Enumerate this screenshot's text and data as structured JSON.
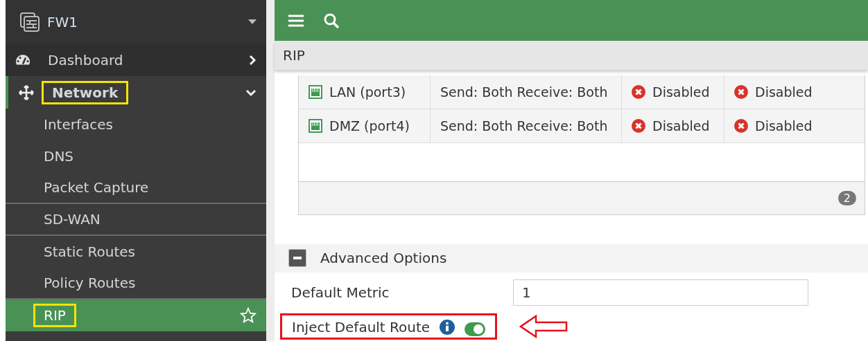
{
  "sidebar": {
    "device": "FW1",
    "items": [
      {
        "label": "Dashboard",
        "kind": "section",
        "expanded": false,
        "selected": false,
        "highlighted": false,
        "separated": false
      },
      {
        "label": "Network",
        "kind": "section",
        "expanded": true,
        "selected": false,
        "highlighted": true,
        "separated": false
      },
      {
        "label": "Interfaces",
        "kind": "sub",
        "selected": false,
        "highlighted": false,
        "separated": false
      },
      {
        "label": "DNS",
        "kind": "sub",
        "selected": false,
        "highlighted": false,
        "separated": false
      },
      {
        "label": "Packet Capture",
        "kind": "sub",
        "selected": false,
        "highlighted": false,
        "separated": true
      },
      {
        "label": "SD-WAN",
        "kind": "sub",
        "selected": false,
        "highlighted": false,
        "separated": true
      },
      {
        "label": "Static Routes",
        "kind": "sub",
        "selected": false,
        "highlighted": false,
        "separated": false
      },
      {
        "label": "Policy Routes",
        "kind": "sub",
        "selected": false,
        "highlighted": false,
        "separated": true
      },
      {
        "label": "RIP",
        "kind": "sub",
        "selected": true,
        "highlighted": true,
        "separated": false
      }
    ]
  },
  "breadcrumb": "RIP",
  "table": {
    "rows": [
      {
        "interface": "LAN (port3)",
        "mode": "Send: Both Receive: Both",
        "column_3": {
          "text": "Disabled",
          "enabled": false
        },
        "column_4": {
          "text": "Disabled",
          "enabled": false
        }
      },
      {
        "interface": "DMZ (port4)",
        "mode": "Send: Both Receive: Both",
        "column_3": {
          "text": "Disabled",
          "enabled": false
        },
        "column_4": {
          "text": "Disabled",
          "enabled": false
        }
      }
    ],
    "count": "2"
  },
  "advanced": {
    "title": "Advanced Options",
    "expanded": true,
    "default_metric": {
      "label": "Default Metric",
      "value": "1"
    },
    "inject_default_route": {
      "label": "Inject Default Route",
      "on": true,
      "highlighted": true
    }
  }
}
